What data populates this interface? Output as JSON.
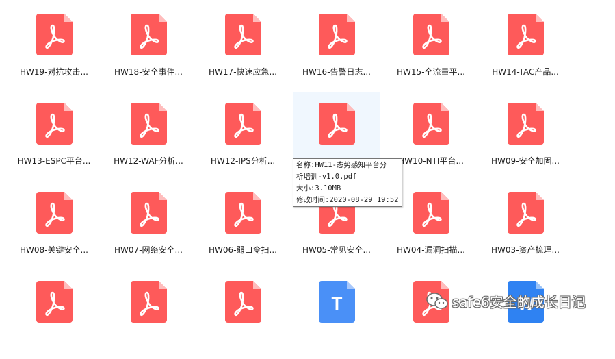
{
  "colors": {
    "pdf": "#fe5a5a",
    "pdf_fold": "#ffbcbc",
    "txt": "#4a90f7",
    "txt_fold": "#a8c8fb",
    "doc": "#2f82f2",
    "hover_bg": "#f0f7fe"
  },
  "files": [
    {
      "label": "HW19-对抗攻击...",
      "type": "pdf",
      "icon": "pdf-icon"
    },
    {
      "label": "HW18-安全事件...",
      "type": "pdf",
      "icon": "pdf-icon"
    },
    {
      "label": "HW17-快速应急...",
      "type": "pdf",
      "icon": "pdf-icon"
    },
    {
      "label": "HW16-告警日志...",
      "type": "pdf",
      "icon": "pdf-icon"
    },
    {
      "label": "HW15-全流量平...",
      "type": "pdf",
      "icon": "pdf-icon"
    },
    {
      "label": "HW14-TAC产品...",
      "type": "pdf",
      "icon": "pdf-icon"
    },
    {
      "label": "HW13-ESPC平台...",
      "type": "pdf",
      "icon": "pdf-icon"
    },
    {
      "label": "HW12-WAF分析...",
      "type": "pdf",
      "icon": "pdf-icon"
    },
    {
      "label": "HW12-IPS分析...",
      "type": "pdf",
      "icon": "pdf-icon"
    },
    {
      "label": "",
      "type": "pdf",
      "icon": "pdf-icon",
      "hovered": true
    },
    {
      "label": "HW10-NTI平台...",
      "type": "pdf",
      "icon": "pdf-icon"
    },
    {
      "label": "HW09-安全加固...",
      "type": "pdf",
      "icon": "pdf-icon"
    },
    {
      "label": "HW08-关键安全...",
      "type": "pdf",
      "icon": "pdf-icon"
    },
    {
      "label": "HW07-网络安全...",
      "type": "pdf",
      "icon": "pdf-icon"
    },
    {
      "label": "HW06-弱口令扫...",
      "type": "pdf",
      "icon": "pdf-icon"
    },
    {
      "label": "HW05-常见安全...",
      "type": "pdf",
      "icon": "pdf-icon"
    },
    {
      "label": "HW04-漏洞扫描...",
      "type": "pdf",
      "icon": "pdf-icon"
    },
    {
      "label": "HW03-资产梳理...",
      "type": "pdf",
      "icon": "pdf-icon"
    },
    {
      "label": "",
      "type": "pdf",
      "icon": "pdf-icon"
    },
    {
      "label": "",
      "type": "pdf",
      "icon": "pdf-icon"
    },
    {
      "label": "",
      "type": "pdf",
      "icon": "pdf-icon"
    },
    {
      "label": "",
      "type": "txt",
      "icon": "text-file-icon",
      "glyph": "T"
    },
    {
      "label": "",
      "type": "pdf",
      "icon": "pdf-icon"
    },
    {
      "label": "",
      "type": "doc",
      "icon": "word-file-icon",
      "glyph": "W"
    }
  ],
  "tooltip": {
    "name_line1": "名称:HW11-态势感知平台分",
    "name_line2": "析培训-v1.0.pdf",
    "size": "大小:3.10MB",
    "modified": "修改时间:2020-08-29 19:52"
  },
  "watermark": {
    "text": "safe6安全的成长日记",
    "icon": "wechat-icon"
  }
}
